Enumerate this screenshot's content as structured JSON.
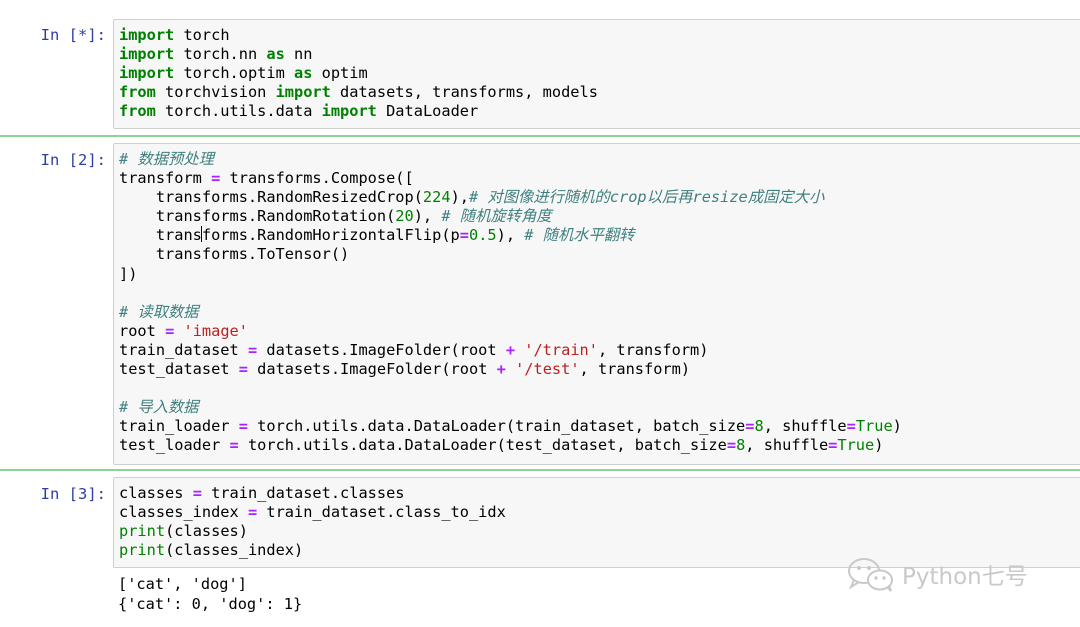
{
  "cells": [
    {
      "prompt": "In [*]:",
      "code_lines": [
        "import torch",
        "import torch.nn as nn",
        "import torch.optim as optim",
        "from torchvision import datasets, transforms, models",
        "from torch.utils.data import DataLoader"
      ]
    },
    {
      "prompt": "In [2]:",
      "code_lines": [
        "# 数据预处理",
        "transform = transforms.Compose([",
        "    transforms.RandomResizedCrop(224),# 对图像进行随机的crop以后再resize成固定大小",
        "    transforms.RandomRotation(20), # 随机旋转角度",
        "    transforms.RandomHorizontalFlip(p=0.5), # 随机水平翻转",
        "    transforms.ToTensor()",
        "])",
        "",
        "# 读取数据",
        "root = 'image'",
        "train_dataset = datasets.ImageFolder(root + '/train', transform)",
        "test_dataset = datasets.ImageFolder(root + '/test', transform)",
        "",
        "# 导入数据",
        "train_loader = torch.utils.data.DataLoader(train_dataset, batch_size=8, shuffle=True)",
        "test_loader = torch.utils.data.DataLoader(test_dataset, batch_size=8, shuffle=True)"
      ]
    },
    {
      "prompt": "In [3]:",
      "code_lines": [
        "classes = train_dataset.classes",
        "classes_index = train_dataset.class_to_idx",
        "print(classes)",
        "print(classes_index)"
      ],
      "output_lines": [
        "['cat', 'dog']",
        "{'cat': 0, 'dog': 1}"
      ]
    }
  ],
  "watermark": {
    "text": "Python七号",
    "icon": "wechat-icon"
  },
  "colors": {
    "prompt": "#303F9F",
    "keyword": "#008000",
    "operator": "#AA22FF",
    "string": "#BA2121",
    "number": "#008000",
    "comment": "#408080",
    "cell_separator": "#6fbf73",
    "input_background": "#f7f7f7"
  }
}
